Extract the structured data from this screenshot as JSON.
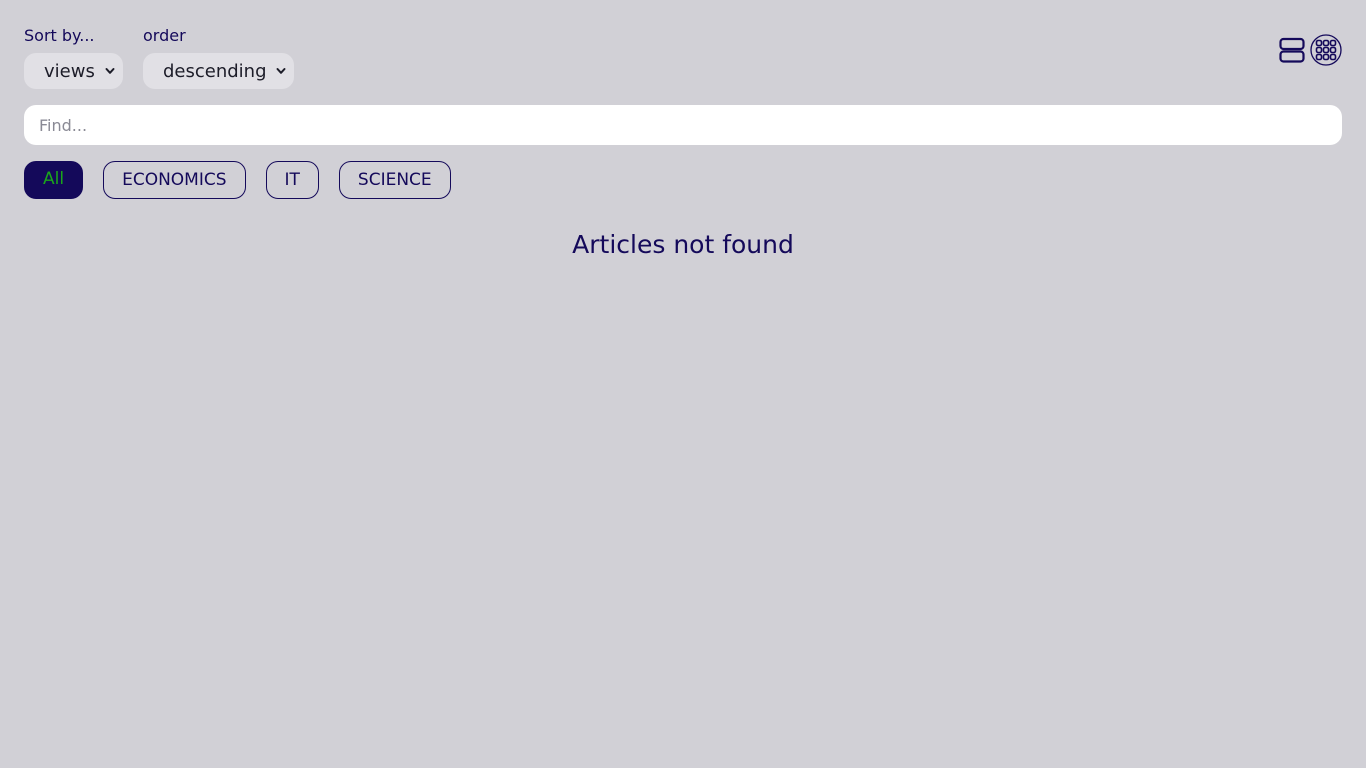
{
  "sort": {
    "label": "Sort by...",
    "selected": "views"
  },
  "order": {
    "label": "order",
    "selected": "descending"
  },
  "search": {
    "placeholder": "Find..."
  },
  "tabs": [
    {
      "label": "All",
      "active": true
    },
    {
      "label": "ECONOMICS",
      "active": false
    },
    {
      "label": "IT",
      "active": false
    },
    {
      "label": "SCIENCE",
      "active": false
    }
  ],
  "view_switch": {
    "list_icon": "list-view-icon",
    "grid_icon": "grid-view-icon",
    "selected": "grid"
  },
  "empty_message": "Articles not found",
  "colors": {
    "background": "#d1d0d6",
    "accent": "#14095a",
    "active_tab_text": "#1aa71a"
  }
}
